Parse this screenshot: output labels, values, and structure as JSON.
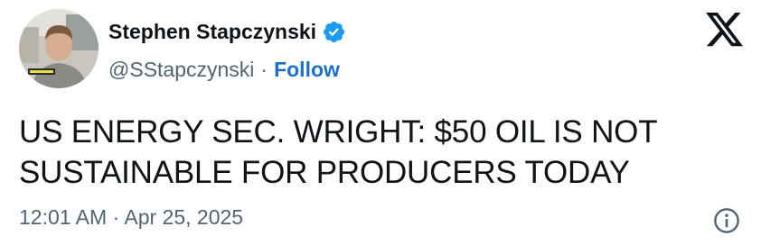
{
  "author": {
    "display_name": "Stephen Stapczynski",
    "handle": "@SStapczynski",
    "separator": "·",
    "follow_label": "Follow",
    "verified_icon": "verified-badge-icon",
    "avatar": "avatar-photo"
  },
  "tweet": {
    "text_line_1": "US ENERGY SEC. WRIGHT: $50 OIL IS NOT",
    "text_line_2": "SUSTAINABLE FOR PRODUCERS TODAY",
    "time": "12:01 AM",
    "date_separator": "·",
    "date": "Apr 25, 2025"
  },
  "icons": {
    "platform_logo": "x-logo-icon",
    "info": "info-icon"
  },
  "colors": {
    "text_primary": "#0f1419",
    "text_secondary": "#536471",
    "follow_link": "#1d70c9",
    "verified_badge": "#1d9bf0"
  }
}
